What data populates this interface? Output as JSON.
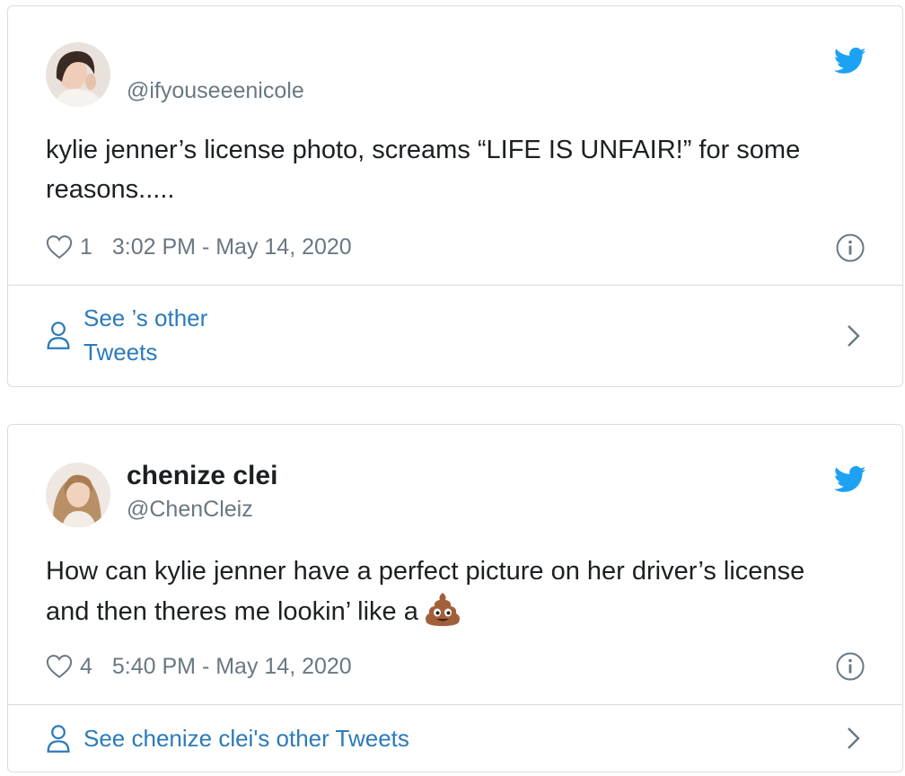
{
  "colors": {
    "link": "#2b7bb9",
    "muted": "#697882",
    "text": "#1c2022",
    "border": "#d5dde2",
    "bird": "#1da1f2"
  },
  "tweets": [
    {
      "display_name": "",
      "handle": "@ifyouseeenicole",
      "text": "kylie jenner’s license photo, screams “LIFE IS UNFAIR!” for some reasons.....",
      "likes": "1",
      "timestamp": "3:02 PM - May 14, 2020",
      "see_other": "See ’s other Tweets"
    },
    {
      "display_name": "chenize clei",
      "handle": "@ChenCleiz",
      "text": "How can kylie jenner have a perfect picture on her driver’s license and then theres me lookin’ like a",
      "text_emoji": "pile-of-poo-emoji",
      "likes": "4",
      "timestamp": "5:40 PM - May 14, 2020",
      "see_other": "See chenize clei's other Tweets"
    }
  ],
  "icons": [
    "twitter-bird-icon",
    "heart-icon",
    "info-icon",
    "person-icon",
    "chevron-right-icon"
  ]
}
